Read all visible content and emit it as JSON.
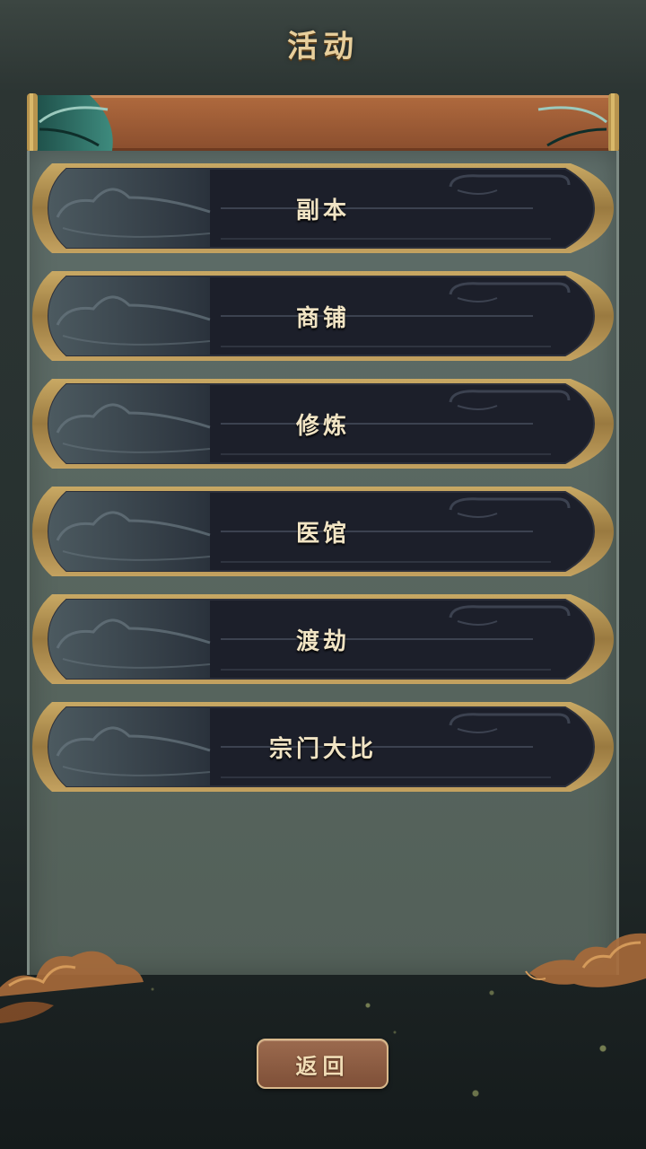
{
  "header": {
    "title": "活动"
  },
  "menu": {
    "items": [
      {
        "label": "副本"
      },
      {
        "label": "商铺"
      },
      {
        "label": "修炼"
      },
      {
        "label": "医馆"
      },
      {
        "label": "渡劫"
      },
      {
        "label": "宗门大比"
      }
    ]
  },
  "footer": {
    "back_label": "返回"
  },
  "colors": {
    "title_gold": "#e7cf9c",
    "scroll_orange": "#9a5a34",
    "scroll_teal": "#2e6b62",
    "item_dark": "#1c1f2a",
    "item_gold_frame": "#a88a4e",
    "back_button": "#8a5a42"
  },
  "icons": {
    "scroll_left_cap": "scroll-roller-left-icon",
    "scroll_right_cap": "scroll-roller-right-icon",
    "cloud_decor": "cloud-decoration-icon"
  }
}
